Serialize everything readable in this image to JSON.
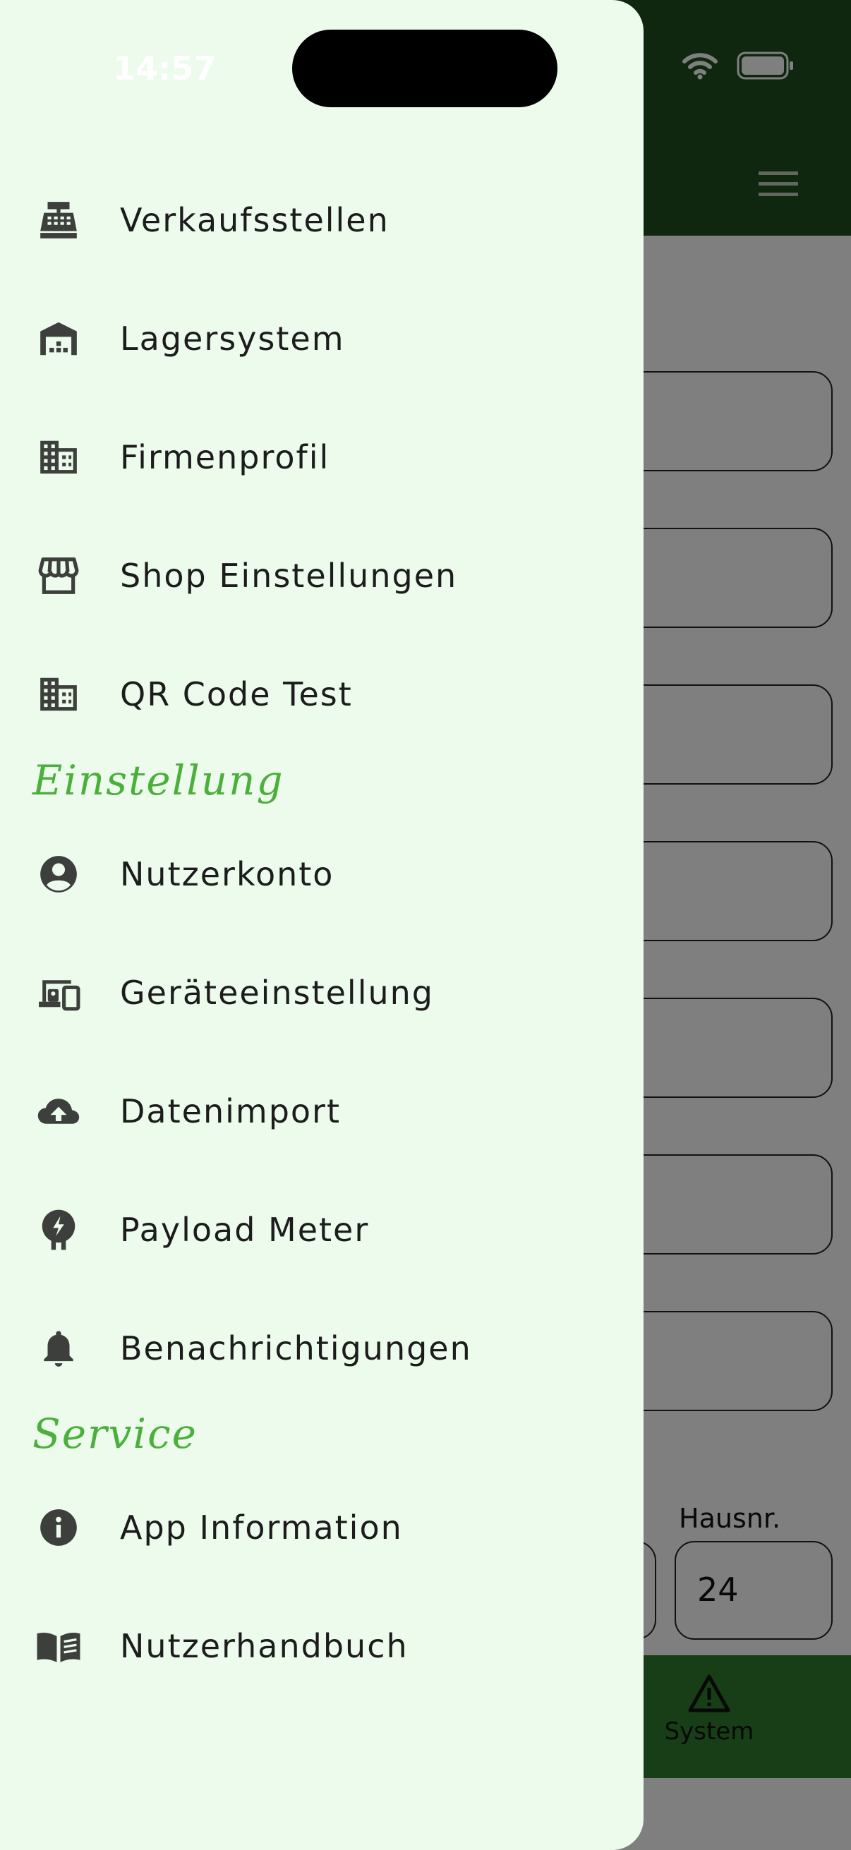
{
  "status_bar": {
    "time": "14:57"
  },
  "drawer": {
    "main_items": [
      {
        "label": "Verkaufsstellen",
        "icon": "cash-register-icon"
      },
      {
        "label": "Lagersystem",
        "icon": "warehouse-icon"
      },
      {
        "label": "Firmenprofil",
        "icon": "building-icon"
      },
      {
        "label": "Shop Einstellungen",
        "icon": "storefront-icon"
      },
      {
        "label": "QR Code Test",
        "icon": "building-icon"
      }
    ],
    "settings_header": "Einstellung",
    "settings_items": [
      {
        "label": "Nutzerkonto",
        "icon": "account-circle-icon"
      },
      {
        "label": "Geräteeinstellung",
        "icon": "devices-icon"
      },
      {
        "label": "Datenimport",
        "icon": "cloud-upload-icon"
      },
      {
        "label": "Payload Meter",
        "icon": "payload-meter-icon"
      },
      {
        "label": "Benachrichtigungen",
        "icon": "bell-icon"
      }
    ],
    "service_header": "Service",
    "service_items": [
      {
        "label": "App Information",
        "icon": "info-icon"
      },
      {
        "label": "Nutzerhandbuch",
        "icon": "book-icon"
      }
    ]
  },
  "background": {
    "hausnr_label": "Hausnr.",
    "hausnr_value": "24",
    "bottom_nav": {
      "system_label": "System"
    }
  },
  "colors": {
    "header_green": "#1f4f1f",
    "nav_green": "#2e7d2e",
    "drawer_bg": "#ecfbec",
    "section_green": "#4caf3c",
    "icon_gray": "#3c3f3c"
  }
}
